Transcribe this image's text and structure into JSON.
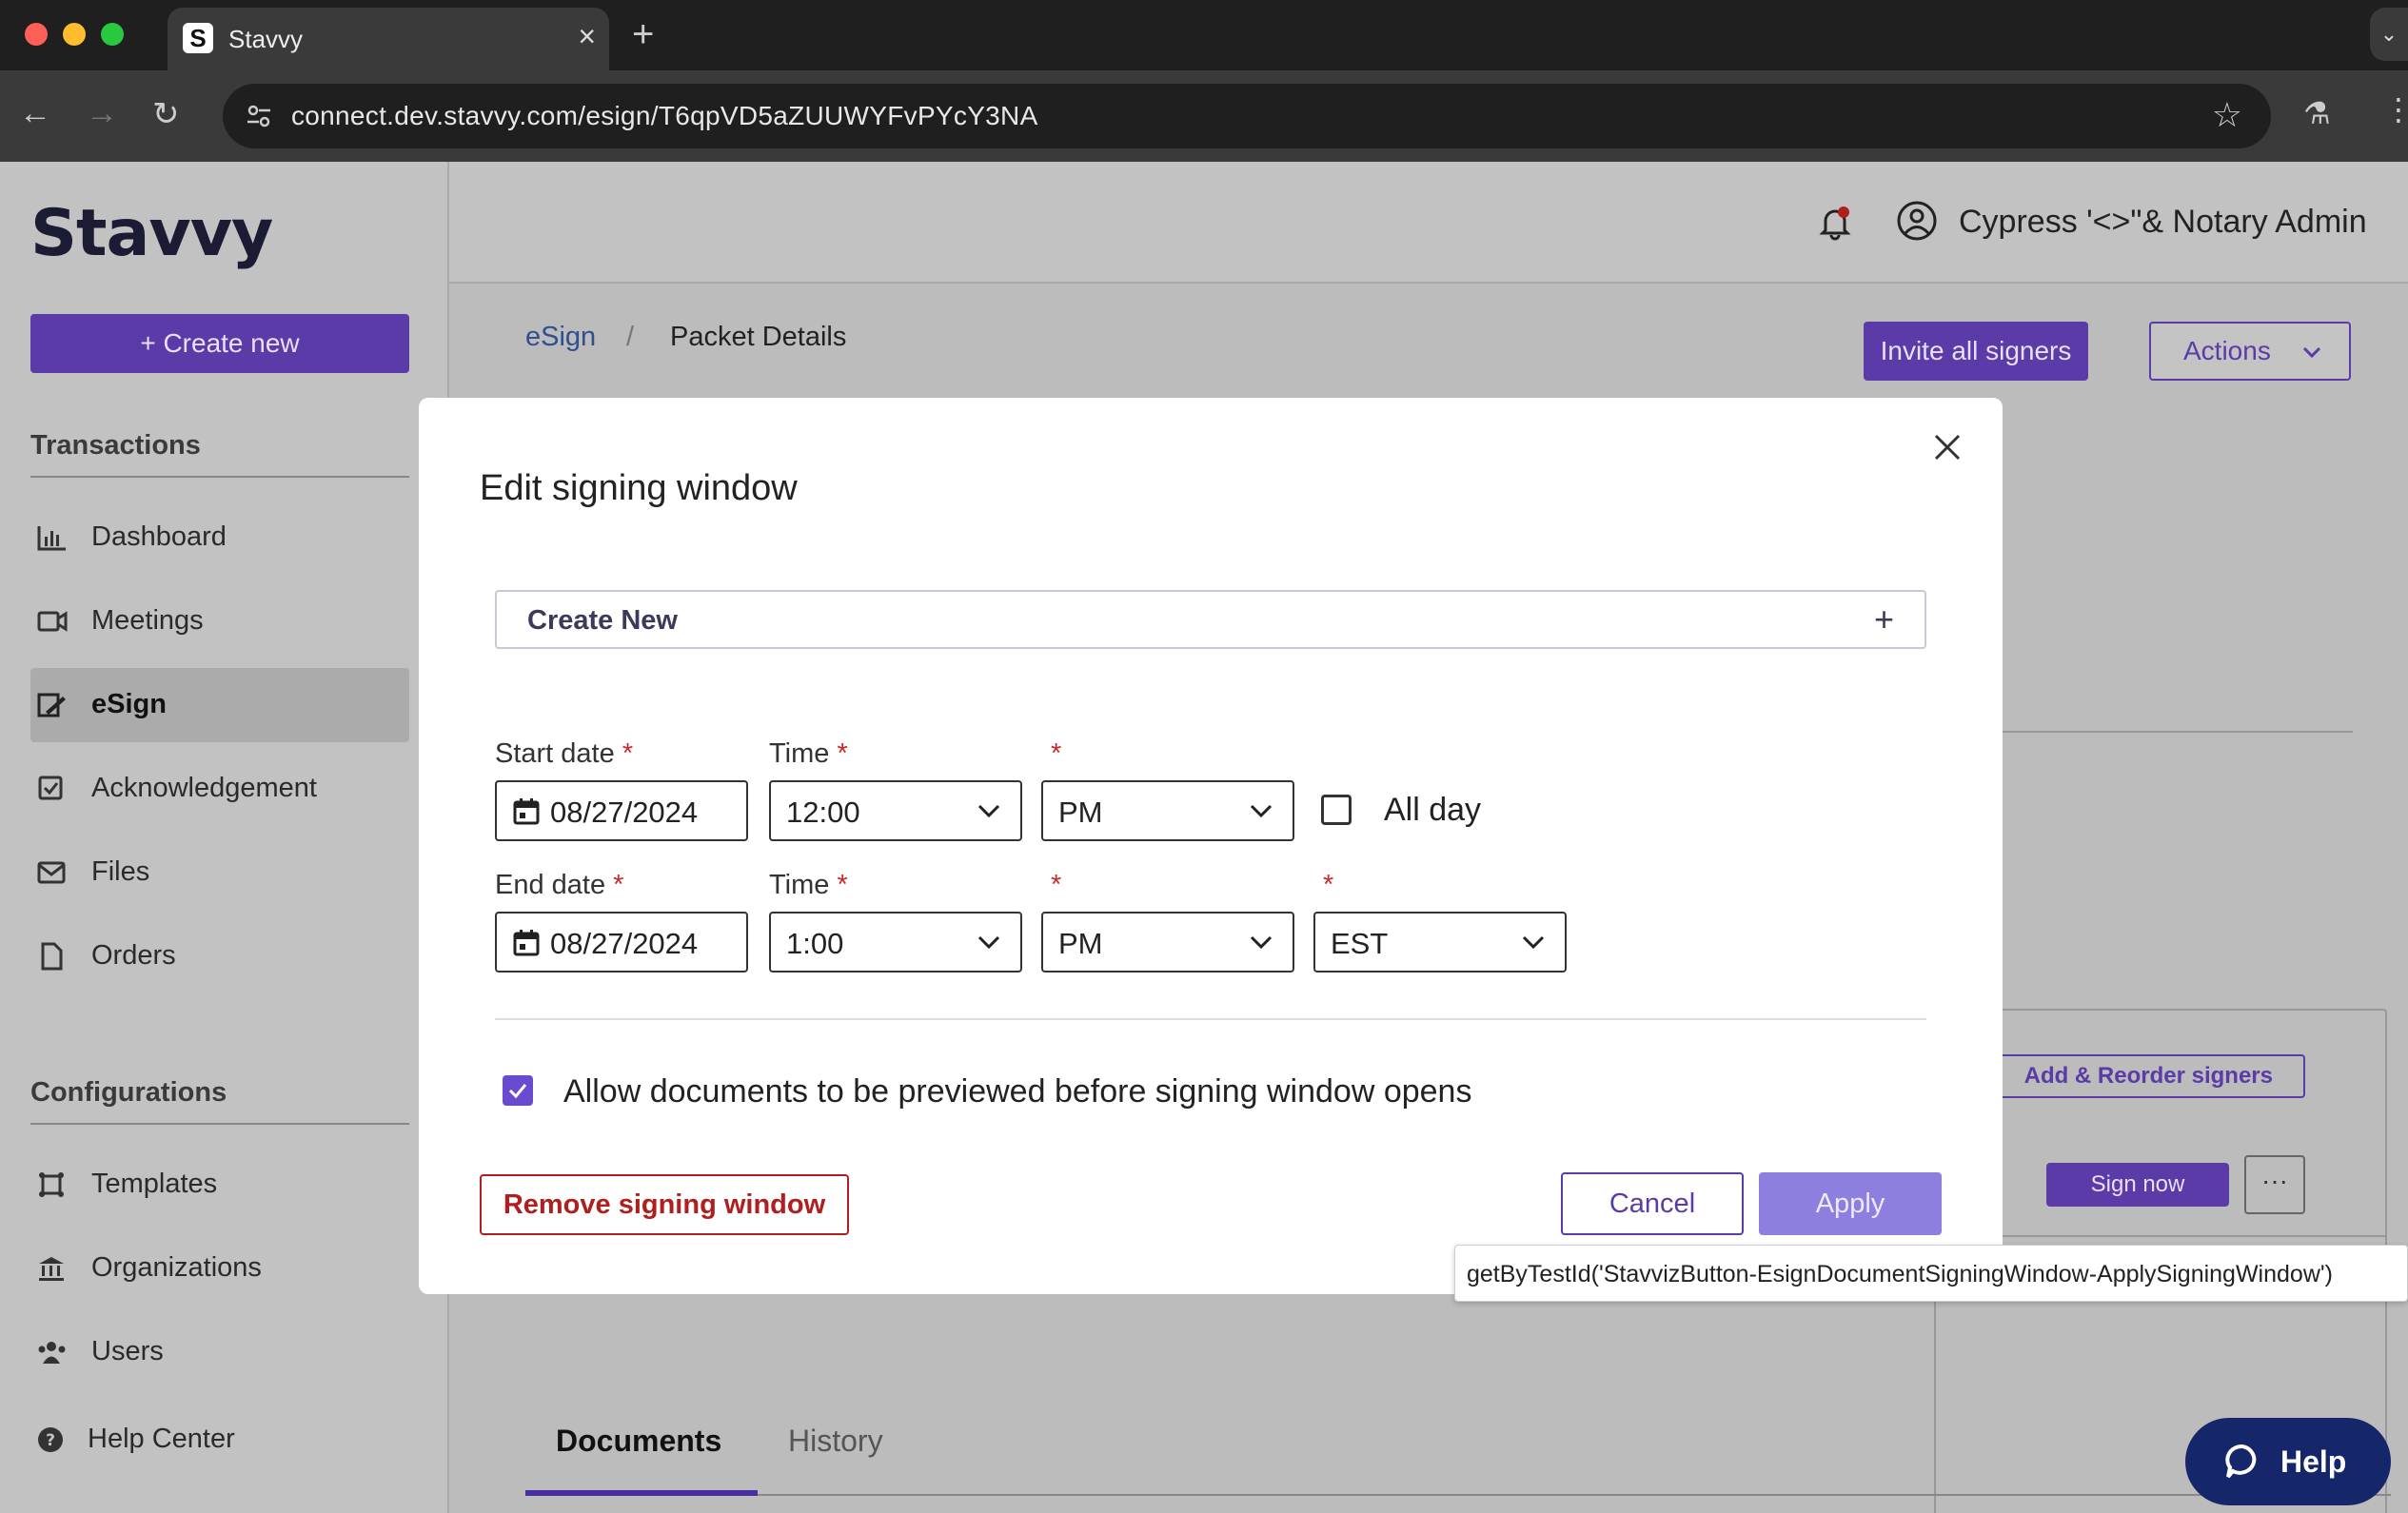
{
  "browser": {
    "tab_title": "Stavvy",
    "tab_favicon": "S",
    "url": "connect.dev.stavvy.com/esign/T6qpVD5aZUUWYFvPYcY3NA"
  },
  "sidebar": {
    "logo": "Stavvy",
    "create_label": "+  Create new",
    "transactions_title": "Transactions",
    "configurations_title": "Configurations",
    "items": [
      {
        "label": "Dashboard",
        "icon": "chart-icon"
      },
      {
        "label": "Meetings",
        "icon": "video-icon"
      },
      {
        "label": "eSign",
        "icon": "sign-icon",
        "active": true
      },
      {
        "label": "Acknowledgement",
        "icon": "checkbox-icon"
      },
      {
        "label": "Files",
        "icon": "mail-icon"
      },
      {
        "label": "Orders",
        "icon": "document-icon"
      }
    ],
    "config_items": [
      {
        "label": "Templates",
        "icon": "template-icon"
      },
      {
        "label": "Organizations",
        "icon": "bank-icon"
      },
      {
        "label": "Users",
        "icon": "users-icon"
      }
    ],
    "help_center": "Help Center"
  },
  "header": {
    "user_name": "Cypress '<>\"& Notary Admin"
  },
  "main": {
    "breadcrumb_root": "eSign",
    "breadcrumb_sep": "/",
    "breadcrumb_current": "Packet Details",
    "invite_label": "Invite all signers",
    "actions_label": "Actions",
    "reorder_label": "Add & Reorder signers",
    "sign_now_label": "Sign now",
    "more_label": "···",
    "tab_documents": "Documents",
    "tab_history": "History"
  },
  "modal": {
    "title": "Edit signing window",
    "create_new_label": "Create New",
    "start_date_label": "Start date",
    "end_date_label": "End date",
    "time_label": "Time",
    "required_mark": "*",
    "start_date": "08/27/2024",
    "start_time": "12:00",
    "start_ampm": "PM",
    "end_date": "08/27/2024",
    "end_time": "1:00",
    "end_ampm": "PM",
    "timezone": "EST",
    "all_day_label": "All day",
    "all_day_checked": false,
    "preview_label": "Allow documents to be previewed before signing window opens",
    "preview_checked": true,
    "remove_label": "Remove signing window",
    "cancel_label": "Cancel",
    "apply_label": "Apply"
  },
  "tooltip": {
    "text": "getByTestId('StavvizButton-EsignDocumentSigningWindow-ApplySigningWindow')"
  },
  "help_button": "Help",
  "colors": {
    "brand": "#5a3ba8",
    "danger": "#b01e1e",
    "apply_disabled": "#8d7fe0",
    "help_navy": "#15266b"
  }
}
